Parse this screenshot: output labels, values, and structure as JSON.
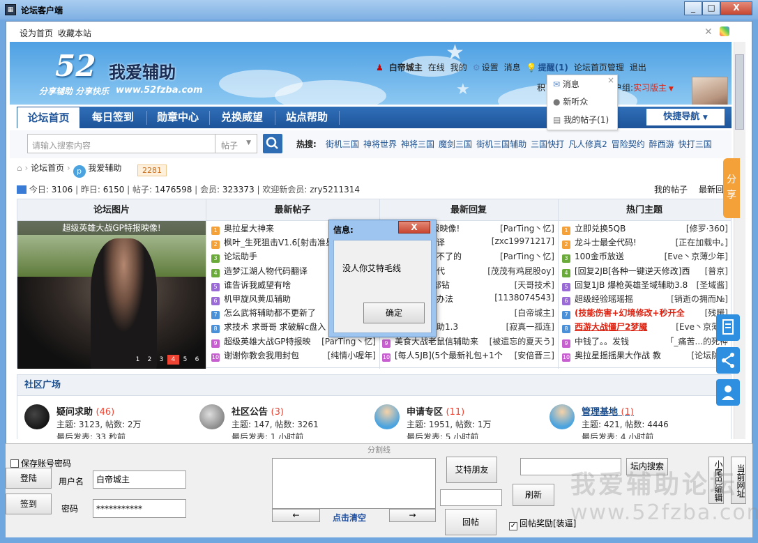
{
  "window": {
    "title": "论坛客户端",
    "buttons": [
      "_",
      "□",
      "X"
    ]
  },
  "topbar": {
    "set_home": "设为首页",
    "bookmark": "收藏本站"
  },
  "logo": {
    "number": "52",
    "name": "我爱辅助",
    "slogan": "分享辅助  分享快乐",
    "url": "www.52fzba.com"
  },
  "usernav": {
    "username": "白帝城主",
    "online": "在线",
    "mine": "我的",
    "settings": "设置",
    "messages": "消息",
    "remind": "提醒(1)",
    "admin": "论坛首页管理",
    "logout": "退出"
  },
  "userinfo": {
    "points_prefix": "积",
    "group_prefix": "户组:",
    "group": "实习版主"
  },
  "dropdown": {
    "items": [
      "消息",
      "新听众",
      "我的帖子(1)"
    ],
    "close": "×"
  },
  "nav": {
    "items": [
      "论坛首页",
      "每日签到",
      "勋章中心",
      "兑换威望",
      "站点帮助"
    ],
    "quick": "快捷导航"
  },
  "search": {
    "placeholder": "请输入搜索内容",
    "type": "帖子",
    "hot_label": "热搜:",
    "hot": [
      "街机三国",
      "神将世界",
      "神将三国",
      "魔剑三国",
      "街机三国辅助",
      "三国快打",
      "凡人修真2",
      "冒险契约",
      "醉西游",
      "快打三国"
    ]
  },
  "breadcrumb": {
    "home": "论坛首页",
    "site": "我爱辅助",
    "badge": "2281"
  },
  "stats": {
    "today_label": "今日:",
    "today": "3106",
    "yesterday_label": "昨日:",
    "yesterday": "6150",
    "posts_label": "帖子:",
    "posts": "1476598",
    "members_label": "会员:",
    "members": "323373",
    "welcome_label": "欢迎新会员:",
    "newest_member": "zry5211314",
    "my_posts": "我的帖子",
    "newest": "最新回"
  },
  "grid": {
    "headers": [
      "论坛图片",
      "最新帖子",
      "最新回复",
      "热门主题"
    ],
    "photo_caption": "超级英雄大战GP特报映像!",
    "pager": [
      "1",
      "2",
      "3",
      "4",
      "5",
      "6"
    ],
    "latest_posts": [
      {
        "t": "奥拉星大神来",
        "a": "[",
        "style": ""
      },
      {
        "t": "枫叶_生死狙击V1.6[射击准星",
        "a": "",
        "style": ""
      },
      {
        "t": "论坛助手",
        "a": "",
        "style": ""
      },
      {
        "t": "造梦江湖人物代码翻译",
        "a": "[zx",
        "style": ""
      },
      {
        "t": "谁告诉我威望有啥",
        "a": "[",
        "style": ""
      },
      {
        "t": "机甲旋风黄瓜辅助",
        "a": "[黑木",
        "style": ""
      },
      {
        "t": "怎么武将辅助都不更新了",
        "a": "",
        "style": ""
      },
      {
        "t": "求技术 求哥哥 求破解c盘入",
        "a": "",
        "style": ""
      },
      {
        "t": "超级英雄大战GP特报映",
        "a": "[ParTing丶忆]",
        "style": ""
      },
      {
        "t": "谢谢你教会我用封包",
        "a": "[纯情小喔年]",
        "style": ""
      }
    ],
    "latest_replies": [
      {
        "t": "大战GP特报映像!",
        "a": "[ParTing丶忆]",
        "style": ""
      },
      {
        "t": "人物代码翻译",
        "a": "[zxc19971217]",
        "style": ""
      },
      {
        "t": "幸运破解用不了的",
        "a": "[ParTing丶忆]",
        "style": ""
      },
      {
        "t": "这个游戏的代",
        "a": "[茂茂有鸡屁股oy]",
        "style": ""
      },
      {
        "t": "】QQ亮全部钻",
        "a": "[天哥技术]",
        "style": ""
      },
      {
        "t": "捕鳄鱼崩溃办法",
        "a": "[1138074543]",
        "style": ""
      },
      {
        "t": "",
        "a": "[白帝城主]",
        "style": ""
      },
      {
        "t": "机甲小子辅助1.3",
        "a": "[寂真一孤连]",
        "style": ""
      },
      {
        "t": "美食大战老鼠信辅助来",
        "a": "[被遗忘的夏天う]",
        "style": ""
      },
      {
        "t": "[每人5JB](5个最新礼包+1个",
        "a": "[安倍晋三]",
        "style": ""
      }
    ],
    "hot_topics": [
      {
        "t": "立即兑换5QB",
        "a": "[修罗·360]",
        "style": ""
      },
      {
        "t": "龙斗士最全代码!",
        "a": "[正在加载中。]",
        "style": ""
      },
      {
        "t": "100金币放送",
        "a": "[Eve丶京薄少年]",
        "style": ""
      },
      {
        "t": "[回复2JB[各种一键逆天修改]西",
        "a": "[普京]",
        "style": ""
      },
      {
        "t": "回复1JB 爆枪英雄圣域辅助3.8",
        "a": "[圣域酱]",
        "style": ""
      },
      {
        "t": "超级经验瑶瑶摇",
        "a": "[销逝の拥而№]",
        "style": ""
      },
      {
        "t": "(技能伤害+幻境修改+秒开全",
        "a": "[残暖]",
        "style": "red"
      },
      {
        "t": "西游大战僵尸2梦魇",
        "a": "[Eve丶京薄少",
        "style": "redu"
      },
      {
        "t": "中钱了。。发钱",
        "a": "「_痛苦...的死神",
        "style": ""
      },
      {
        "t": "奥拉星摇摇果大作战 教",
        "a": "[论坛防水",
        "style": ""
      }
    ]
  },
  "community": {
    "title": "社区广场",
    "forums": [
      {
        "name": "疑问求助",
        "count": "(46)",
        "stat": "主题: 3123, 帖数: 2万",
        "last": "最后发表: 33 秒前"
      },
      {
        "name": "社区公告",
        "count": "(3)",
        "stat": "主题: 147, 帖数: 3261",
        "last": "最后发表: 1 小时前"
      },
      {
        "name": "申请专区",
        "count": "(11)",
        "stat": "主题: 1951, 帖数: 1万",
        "last": "最后发表: 5 小时前"
      },
      {
        "name": "管理基地",
        "count": "(1)",
        "stat": "主题: 421, 帖数: 4446",
        "last": "最后发表: 4 小时前"
      }
    ]
  },
  "share_tab": "分享",
  "dialog": {
    "title": "信息:",
    "message": "没人你艾特毛线",
    "ok": "确定",
    "close": "X"
  },
  "bottom": {
    "split": "分割线",
    "save_pw": "保存账号密码",
    "login": "登陆",
    "signin": "签到",
    "username_label": "用户名",
    "username": "白帝城主",
    "password_label": "密码",
    "password": "***********",
    "prev": "←",
    "clear": "点击清空",
    "next": "→",
    "at_friend": "艾特朋友",
    "reply": "回帖",
    "refresh": "刷新",
    "search_in": "坛内搜索",
    "reward": "回帖奖励[装逼]",
    "tail_edit": "小尾巴编辑",
    "cur_url": "当前网址",
    "watermark": "我爱辅助论坛",
    "watermark_url": "www.52fzba.com"
  }
}
